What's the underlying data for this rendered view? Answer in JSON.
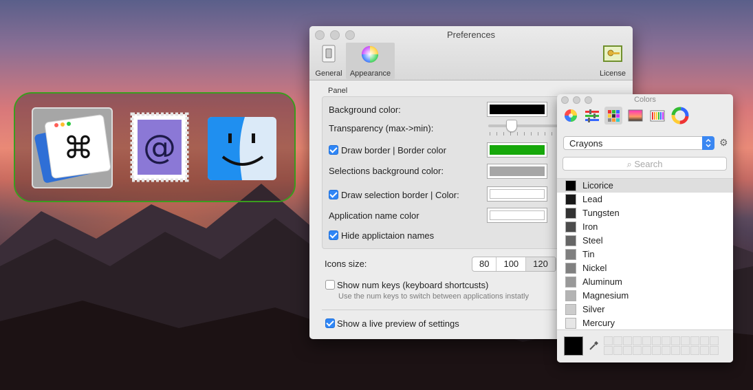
{
  "preferences": {
    "window_title": "Preferences",
    "toolbar": {
      "general": "General",
      "appearance": "Appearance",
      "license": "License"
    },
    "panel": {
      "section_label": "Panel",
      "background_color_label": "Background color:",
      "background_color": "#000000",
      "transparency_label": "Transparency (max->min):",
      "transparency_value": 0.3,
      "draw_border_label": "Draw border | Border color",
      "draw_border_checked": true,
      "border_color": "#16a80a",
      "selections_bg_label": "Selections background color:",
      "selections_bg_color": "#a6a6a6",
      "draw_selection_border_label": "Draw selection border | Color:",
      "draw_selection_border_checked": true,
      "selection_border_color": "#ffffff",
      "app_name_color_label": "Application name color",
      "app_name_color": "#ffffff",
      "hide_app_names_label": "Hide applictaion names",
      "hide_app_names_checked": true
    },
    "icons_size": {
      "label": "Icons size:",
      "options": [
        "80",
        "100",
        "120"
      ],
      "selected": "120"
    },
    "show_num_keys_label": "Show num keys (keyboard shortcusts)",
    "show_num_keys_checked": false,
    "show_num_keys_hint": "Use the num keys to switch between applications instatly",
    "live_preview_label": "Show a live preview of settings",
    "live_preview_checked": true
  },
  "colors_panel": {
    "title": "Colors",
    "palette_dropdown": "Crayons",
    "search_placeholder": "Search",
    "items": [
      {
        "name": "Licorice",
        "color": "#000000"
      },
      {
        "name": "Lead",
        "color": "#191919"
      },
      {
        "name": "Tungsten",
        "color": "#333333"
      },
      {
        "name": "Iron",
        "color": "#4c4c4c"
      },
      {
        "name": "Steel",
        "color": "#666666"
      },
      {
        "name": "Tin",
        "color": "#7f7f7f"
      },
      {
        "name": "Nickel",
        "color": "#808080"
      },
      {
        "name": "Aluminum",
        "color": "#999999"
      },
      {
        "name": "Magnesium",
        "color": "#b3b3b3"
      },
      {
        "name": "Silver",
        "color": "#cccccc"
      },
      {
        "name": "Mercury",
        "color": "#e6e6e6"
      }
    ],
    "selected_item": "Licorice",
    "current_color": "#000000"
  },
  "switcher": {
    "border_color": "#3a9d1e",
    "apps": [
      "command-app-icon",
      "mail-stamp-icon",
      "finder-icon"
    ]
  }
}
